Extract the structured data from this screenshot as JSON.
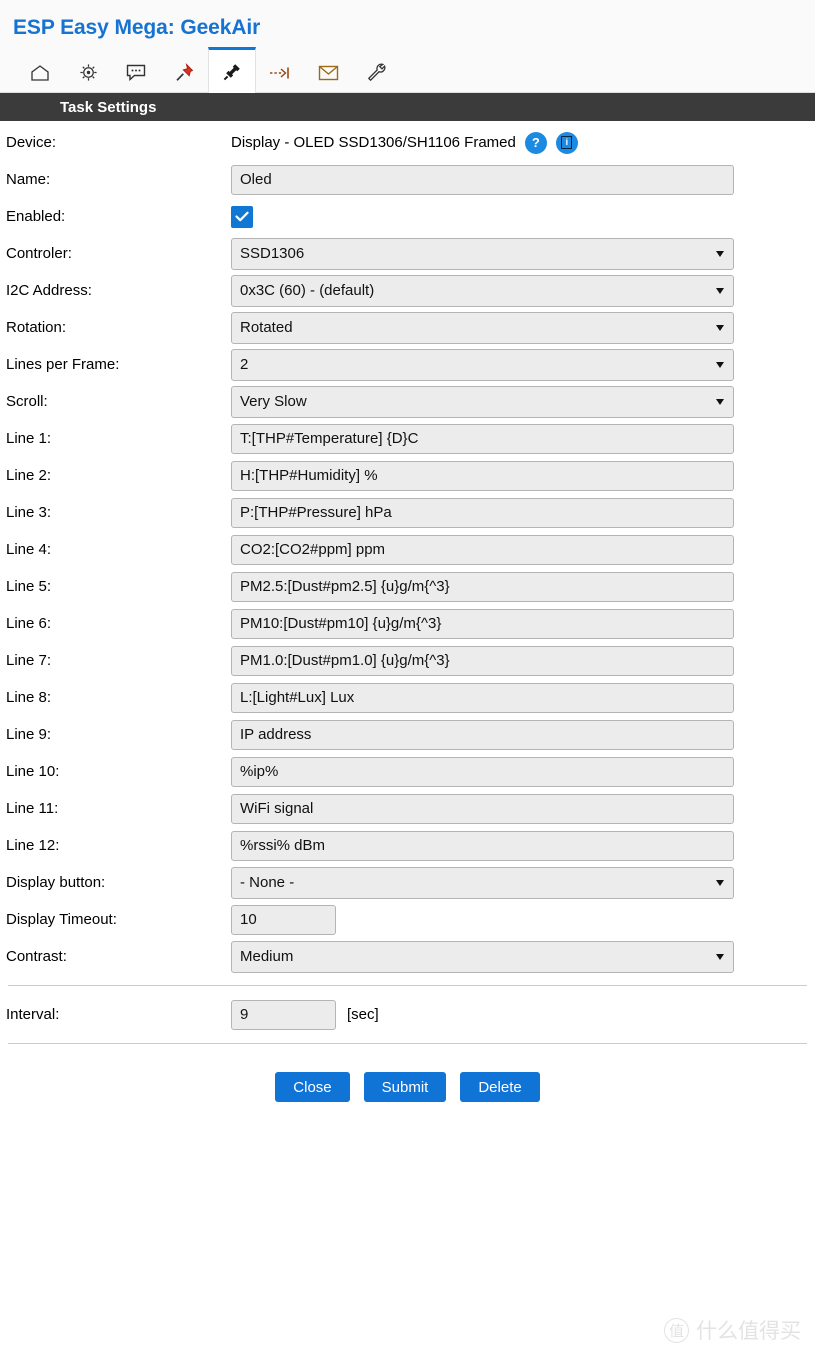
{
  "header": {
    "title": "ESP Easy Mega: GeekAir",
    "tabs": [
      {
        "name": "home",
        "icon": "home-icon",
        "active": false
      },
      {
        "name": "config",
        "icon": "gear-icon",
        "active": false
      },
      {
        "name": "controllers",
        "icon": "chat-bubble-icon",
        "active": false
      },
      {
        "name": "hardware",
        "icon": "pushpin-icon",
        "active": false
      },
      {
        "name": "devices",
        "icon": "plug-icon",
        "active": true
      },
      {
        "name": "rules",
        "icon": "arrow-to-bar-icon",
        "active": false
      },
      {
        "name": "notifications",
        "icon": "envelope-icon",
        "active": false
      },
      {
        "name": "tools",
        "icon": "wrench-icon",
        "active": false
      }
    ]
  },
  "section": {
    "title": "Task Settings"
  },
  "form": {
    "device": {
      "label": "Device:",
      "value": "Display - OLED SSD1306/SH1106 Framed",
      "help_glyph": "?",
      "info_glyph": "i"
    },
    "name": {
      "label": "Name:",
      "value": "Oled"
    },
    "enabled": {
      "label": "Enabled:",
      "checked": true
    },
    "controler": {
      "label": "Controler:",
      "value": "SSD1306"
    },
    "i2c_address": {
      "label": "I2C Address:",
      "value": "0x3C (60) - (default)"
    },
    "rotation": {
      "label": "Rotation:",
      "value": "Rotated"
    },
    "lines_per_frame": {
      "label": "Lines per Frame:",
      "value": "2"
    },
    "scroll": {
      "label": "Scroll:",
      "value": "Very Slow"
    },
    "lines": [
      {
        "label": "Line 1:",
        "value": "T:[THP#Temperature] {D}C"
      },
      {
        "label": "Line 2:",
        "value": "H:[THP#Humidity] %"
      },
      {
        "label": "Line 3:",
        "value": "P:[THP#Pressure] hPa"
      },
      {
        "label": "Line 4:",
        "value": "CO2:[CO2#ppm] ppm"
      },
      {
        "label": "Line 5:",
        "value": "PM2.5:[Dust#pm2.5] {u}g/m{^3}"
      },
      {
        "label": "Line 6:",
        "value": "PM10:[Dust#pm10] {u}g/m{^3}"
      },
      {
        "label": "Line 7:",
        "value": "PM1.0:[Dust#pm1.0] {u}g/m{^3}"
      },
      {
        "label": "Line 8:",
        "value": "L:[Light#Lux] Lux"
      },
      {
        "label": "Line 9:",
        "value": "IP address"
      },
      {
        "label": "Line 10:",
        "value": "%ip%"
      },
      {
        "label": "Line 11:",
        "value": "WiFi signal"
      },
      {
        "label": "Line 12:",
        "value": "%rssi% dBm"
      }
    ],
    "display_button": {
      "label": "Display button:",
      "value": "- None -"
    },
    "display_timeout": {
      "label": "Display Timeout:",
      "value": "10"
    },
    "contrast": {
      "label": "Contrast:",
      "value": "Medium"
    },
    "interval": {
      "label": "Interval:",
      "value": "9",
      "unit": "[sec]"
    }
  },
  "buttons": {
    "close": "Close",
    "submit": "Submit",
    "delete": "Delete"
  },
  "watermark": {
    "mark": "值",
    "text": "什么值得买"
  },
  "colors": {
    "title_blue": "#1673d1",
    "accent_blue": "#1073d6",
    "section_bar": "#3b3b3b",
    "input_bg": "#ececec",
    "input_border": "#b4b4b4"
  }
}
